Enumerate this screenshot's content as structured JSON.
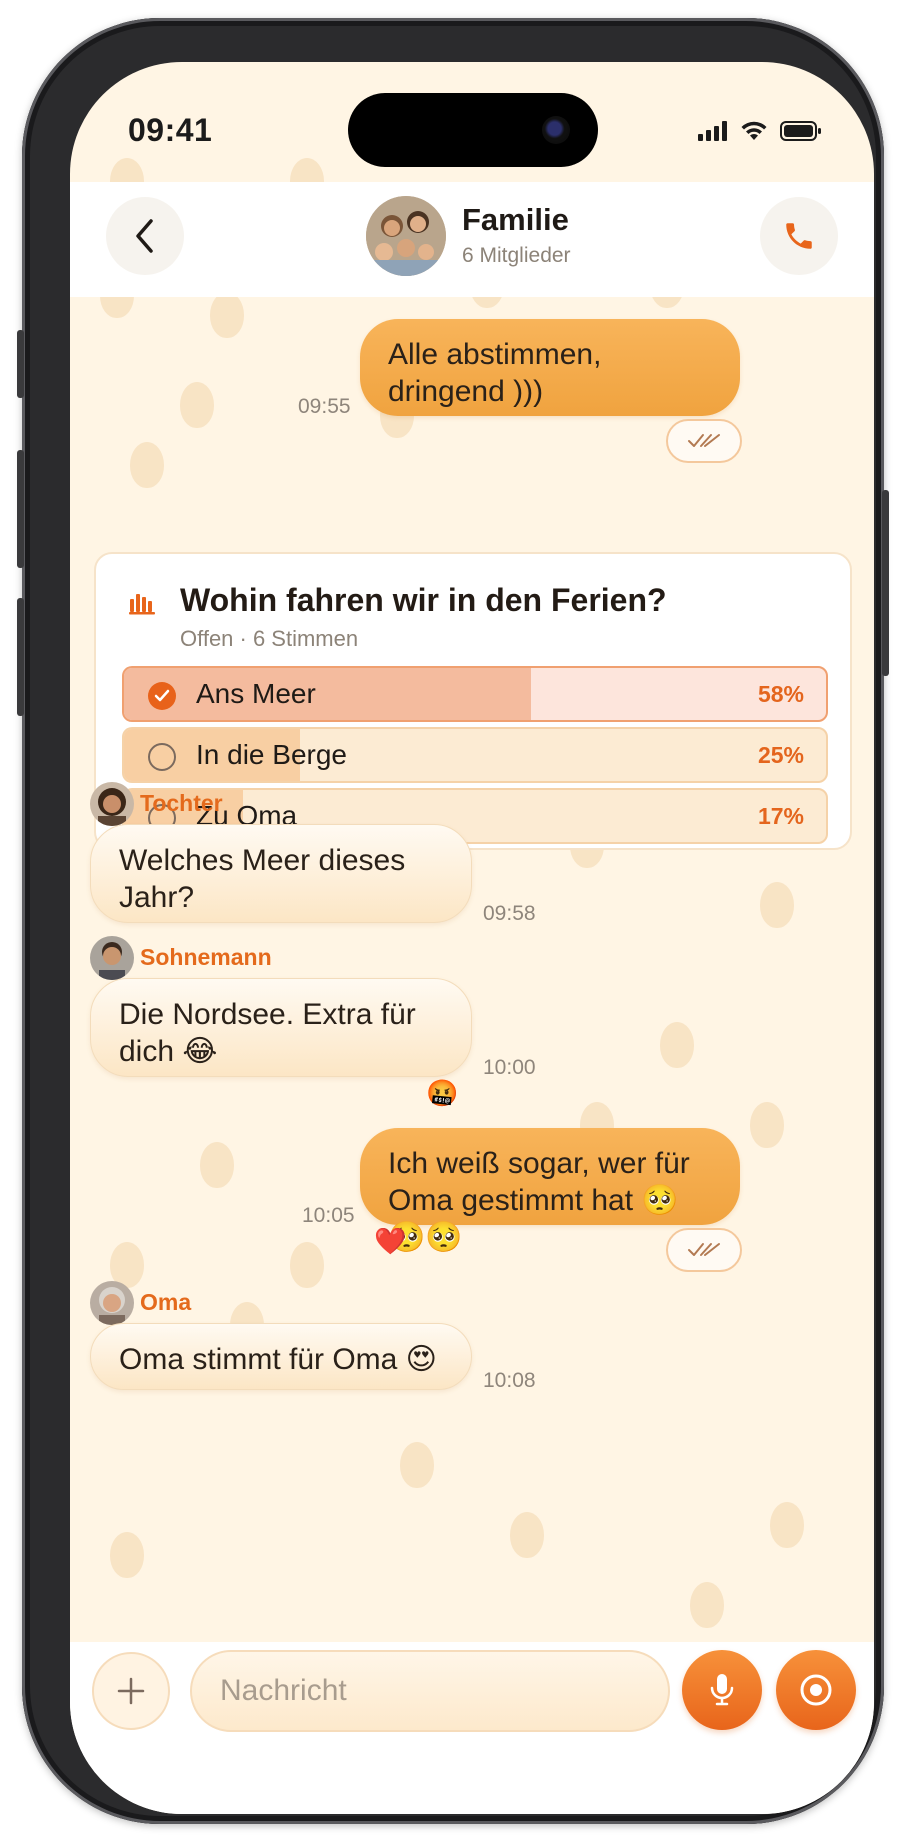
{
  "status_bar": {
    "time": "09:41"
  },
  "header": {
    "group_name": "Familie",
    "member_count": "6 Mitglieder",
    "back_icon": "chevron-left-icon",
    "call_icon": "phone-icon"
  },
  "messages": [
    {
      "id": "m1",
      "direction": "outgoing",
      "text": "Alle abstimmen, dringend )))",
      "time": "09:55",
      "read_receipt": "double-check-icon"
    },
    {
      "id": "m3",
      "direction": "incoming",
      "sender": "Tochter",
      "text": "Welches Meer dieses Jahr?",
      "time": "09:58"
    },
    {
      "id": "m4",
      "direction": "incoming",
      "sender": "Sohnemann",
      "text": "Die Nordsee. Extra für dich 😂",
      "time": "10:00",
      "reaction": "🤬"
    },
    {
      "id": "m5",
      "direction": "outgoing",
      "text": "Ich weiß sogar, wer für Oma gestimmt hat 🥺🥺🥺",
      "time": "10:05",
      "reaction": "❤️",
      "read_receipt": "double-check-icon"
    },
    {
      "id": "m6",
      "direction": "incoming",
      "sender": "Oma",
      "text": "Oma stimmt für Oma 😍",
      "time": "10:08"
    }
  ],
  "poll": {
    "title": "Wohin fahren wir in den Ferien?",
    "meta": "Offen · 6 Stimmen",
    "icon": "bar-chart-icon",
    "options": [
      {
        "label": "Ans Meer",
        "percent_label": "58%",
        "share": 0.58,
        "selected": true
      },
      {
        "label": "In die Berge",
        "percent_label": "25%",
        "share": 0.25,
        "selected": false
      },
      {
        "label": "Zu Oma",
        "percent_label": "17%",
        "share": 0.17,
        "selected": false
      }
    ]
  },
  "input_bar": {
    "placeholder": "Nachricht",
    "attach_icon": "plus-icon",
    "mic_icon": "microphone-icon",
    "record_icon": "record-icon"
  },
  "colors": {
    "accent": "#e8651b",
    "outgoing_bubble": "#f5ab4b",
    "incoming_bubble": "#fdeed6",
    "chat_background": "#fff5e4"
  }
}
